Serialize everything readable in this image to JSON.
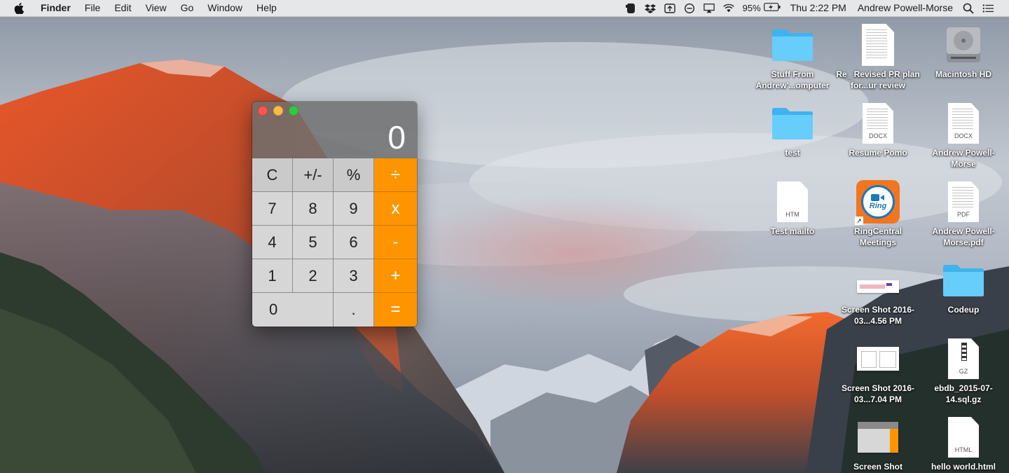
{
  "menubar": {
    "apple_icon": "apple-logo-icon",
    "app_name": "Finder",
    "menus": [
      "File",
      "Edit",
      "View",
      "Go",
      "Window",
      "Help"
    ],
    "battery_percent": "95%",
    "clock": "Thu 2:22 PM",
    "user": "Andrew Powell-Morse",
    "tray_icons": [
      "evernote-icon",
      "dropbox-icon",
      "time-machine-icon",
      "do-not-disturb-icon",
      "airplay-icon",
      "wifi-icon",
      "battery-icon",
      "spotlight-icon",
      "notification-center-icon"
    ]
  },
  "calculator": {
    "display": "0",
    "keys": {
      "clear": "C",
      "sign": "+/-",
      "percent": "%",
      "divide": "÷",
      "seven": "7",
      "eight": "8",
      "nine": "9",
      "multiply": "x",
      "four": "4",
      "five": "5",
      "six": "6",
      "minus": "-",
      "one": "1",
      "two": "2",
      "three": "3",
      "plus": "+",
      "zero": "0",
      "decimal": ".",
      "equals": "="
    }
  },
  "desktop_icons": [
    {
      "label": "Stuff From Andrew'...omputer",
      "kind": "folder"
    },
    {
      "label": "Re_ Revised PR plan for...ur review",
      "kind": "document"
    },
    {
      "label": "Macintosh HD",
      "kind": "hard-drive"
    },
    {
      "label": "test",
      "kind": "folder"
    },
    {
      "label": "Resume Pomo",
      "kind": "document",
      "ext": "DOCX"
    },
    {
      "label": "Andrew Powell-Morse",
      "kind": "document",
      "ext": "DOCX"
    },
    {
      "label": "Test mailto",
      "kind": "document",
      "ext": "HTM"
    },
    {
      "label": "RingCentral Meetings",
      "kind": "app",
      "app_word": "Ring"
    },
    {
      "label": "Andrew Powell-Morse.pdf",
      "kind": "document",
      "ext": "PDF"
    },
    {
      "label": "Screen Shot 2016-03...4.56 PM",
      "kind": "screenshot"
    },
    {
      "label": "Codeup",
      "kind": "folder"
    },
    {
      "label": "Screen Shot 2016-03...7.04 PM",
      "kind": "screenshot"
    },
    {
      "label": "ebdb_2015-07-14.sql.gz",
      "kind": "document",
      "ext": "GZ"
    },
    {
      "label": "Screen Shot",
      "kind": "screenshot"
    },
    {
      "label": "hello world.html",
      "kind": "document",
      "ext": "HTML"
    }
  ],
  "colors": {
    "operator_orange": "#fe9500",
    "folder_blue": "#4fc1f5",
    "ring_orange": "#f2761f",
    "ring_blue": "#1d77b8"
  }
}
